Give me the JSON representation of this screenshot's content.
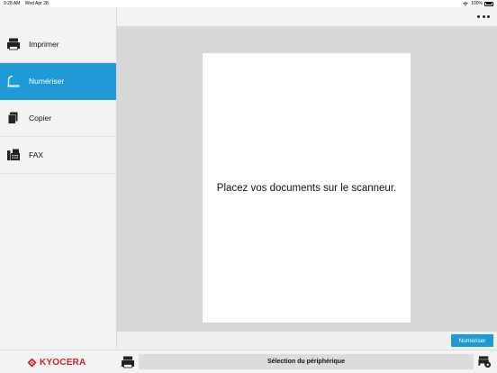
{
  "status_bar": {
    "time": "9:28 AM",
    "date": "Wed Apr 28",
    "battery": "100%"
  },
  "sidebar": {
    "items": [
      {
        "label": "Imprimer",
        "icon": "printer-icon",
        "active": false
      },
      {
        "label": "Numériser",
        "icon": "scanner-icon",
        "active": true
      },
      {
        "label": "Copier",
        "icon": "copy-icon",
        "active": false
      },
      {
        "label": "FAX",
        "icon": "fax-icon",
        "active": false
      }
    ]
  },
  "header": {
    "more_icon": "more-horizontal-icon"
  },
  "preview": {
    "message": "Placez vos documents sur le scanneur."
  },
  "actions": {
    "scan_label": "Numériser"
  },
  "bottom": {
    "brand": "KYOCERA",
    "device_select_label": "Sélection du périphérique",
    "printer_icon": "printer-icon",
    "settings_icon": "device-settings-icon"
  },
  "colors": {
    "accent": "#1f9ad6",
    "brand": "#d3202e",
    "preview_bg": "#d7d7d7",
    "sidebar_bg": "#f3f3f3"
  }
}
